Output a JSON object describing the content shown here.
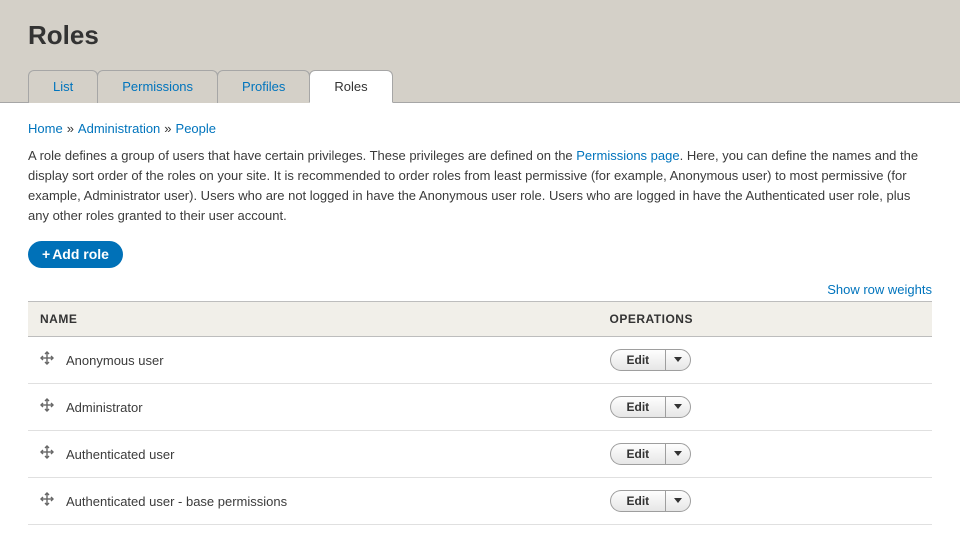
{
  "page": {
    "title": "Roles"
  },
  "tabs": [
    {
      "label": "List",
      "active": false
    },
    {
      "label": "Permissions",
      "active": false
    },
    {
      "label": "Profiles",
      "active": false
    },
    {
      "label": "Roles",
      "active": true
    }
  ],
  "breadcrumb": {
    "items": [
      "Home",
      "Administration",
      "People"
    ],
    "separator": "»"
  },
  "description": {
    "pre": "A role defines a group of users that have certain privileges. These privileges are defined on the ",
    "link": "Permissions page",
    "post": ". Here, you can define the names and the display sort order of the roles on your site. It is recommended to order roles from least permissive (for example, Anonymous user) to most permissive (for example, Administrator user). Users who are not logged in have the Anonymous user role. Users who are logged in have the Authenticated user role, plus any other roles granted to their user account."
  },
  "add_button": {
    "label": "Add role",
    "plus": "+"
  },
  "show_weights": "Show row weights",
  "table": {
    "headers": {
      "name": "NAME",
      "operations": "OPERATIONS"
    },
    "edit_label": "Edit",
    "rows": [
      {
        "name": "Anonymous user"
      },
      {
        "name": "Administrator"
      },
      {
        "name": "Authenticated user"
      },
      {
        "name": "Authenticated user - base permissions"
      }
    ]
  }
}
